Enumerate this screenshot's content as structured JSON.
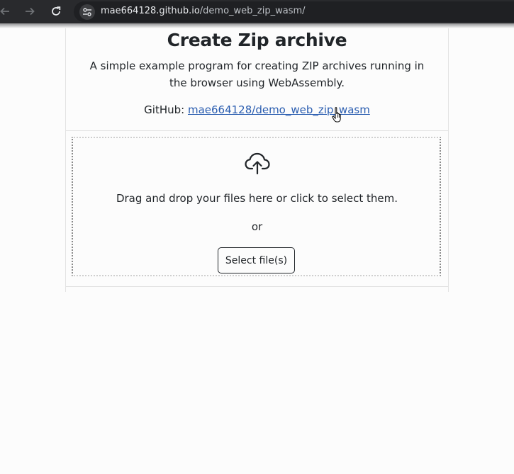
{
  "browser": {
    "url_host": "mae664128.github.io",
    "url_path": "/demo_web_zip_wasm/",
    "back_icon": "arrow-left-icon",
    "forward_icon": "arrow-right-icon",
    "reload_icon": "reload-icon",
    "site_info_icon": "tune-icon"
  },
  "page": {
    "title": "Create Zip archive",
    "description": "A simple example program for creating ZIP archives running in the browser using WebAssembly.",
    "github_label": "GitHub: ",
    "github_link": "mae664128/demo_web_zip_wasm",
    "dropzone": {
      "icon": "cloud-upload-icon",
      "instruction": "Drag and drop your files here or click to select them.",
      "or": "or",
      "button_label": "Select file(s)"
    }
  },
  "colors": {
    "toolbar": "#292a2d",
    "link": "#2a5db0",
    "text": "#212529"
  }
}
